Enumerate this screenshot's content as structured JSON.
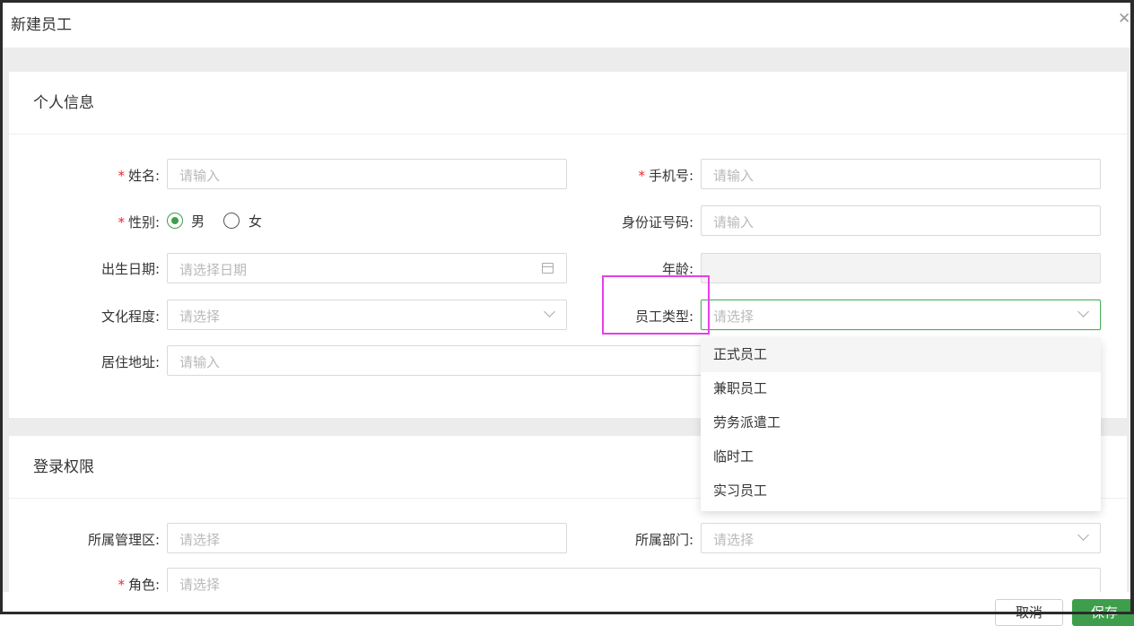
{
  "dialog": {
    "title": "新建员工",
    "close_icon": "close-icon"
  },
  "personal_section": {
    "title": "个人信息",
    "name": {
      "label": "姓名:",
      "required": true,
      "placeholder": "请输入"
    },
    "phone": {
      "label": "手机号:",
      "required": true,
      "placeholder": "请输入"
    },
    "gender": {
      "label": "性别:",
      "required": true,
      "options": [
        "男",
        "女"
      ],
      "selected": "男"
    },
    "id_number": {
      "label": "身份证号码:",
      "placeholder": "请输入"
    },
    "birth_date": {
      "label": "出生日期:",
      "placeholder": "请选择日期",
      "icon": "calendar-icon"
    },
    "age": {
      "label": "年龄:",
      "value": ""
    },
    "education": {
      "label": "文化程度:",
      "placeholder": "请选择"
    },
    "employee_type": {
      "label": "员工类型:",
      "placeholder": "请选择",
      "focused": true
    },
    "address": {
      "label": "居住地址:",
      "placeholder": "请输入"
    }
  },
  "employee_type_dropdown": {
    "options": [
      "正式员工",
      "兼职员工",
      "劳务派遣工",
      "临时工",
      "实习员工"
    ],
    "hovered_index": 0
  },
  "login_section": {
    "title": "登录权限",
    "management_area": {
      "label": "所属管理区:",
      "placeholder": "请选择"
    },
    "department": {
      "label": "所属部门:",
      "placeholder": "请选择"
    },
    "role": {
      "label": "角色:",
      "required": true,
      "placeholder": "请选择"
    }
  },
  "footer": {
    "cancel_label": "取消",
    "save_label": "保存"
  },
  "colors": {
    "accent": "#3e9e4c",
    "required": "#f5222d",
    "highlight": "#e83ee8"
  }
}
